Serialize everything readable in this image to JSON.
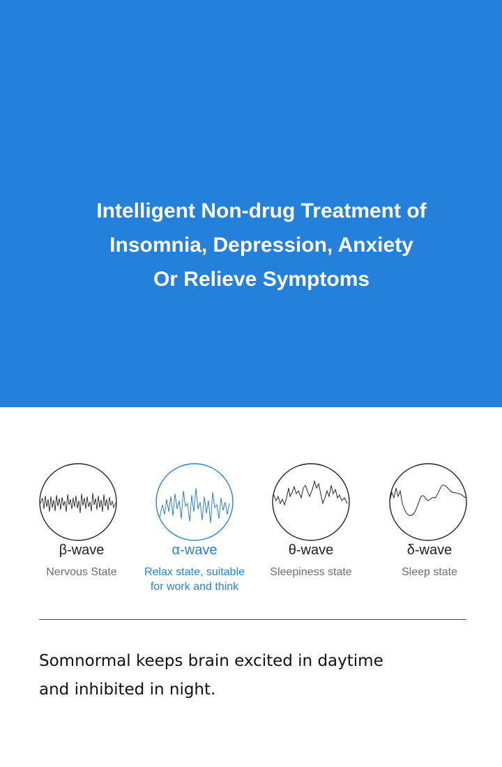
{
  "hero": {
    "title_lines": [
      "Intelligent Non-drug Treatment of",
      "Insomnia, Depression, Anxiety",
      "Or Relieve Symptoms"
    ]
  },
  "colors": {
    "hero_background": "#2480d8",
    "accent": "#2a7fd2",
    "text_dark": "#1e1e1e",
    "text_muted": "#6c6c6c"
  },
  "waves": [
    {
      "name": "β-wave",
      "description": "Nervous State",
      "icon": "beta-wave-icon",
      "highlighted": false
    },
    {
      "name": "α-wave",
      "description": "Relax state,  suitable\nfor work and think",
      "icon": "alpha-wave-icon",
      "highlighted": true
    },
    {
      "name": "θ-wave",
      "description": "Sleepiness state",
      "icon": "theta-wave-icon",
      "highlighted": false
    },
    {
      "name": "δ-wave",
      "description": "Sleep state",
      "icon": "delta-wave-icon",
      "highlighted": false
    }
  ],
  "tagline": {
    "lines": [
      "Somnormal keeps brain excited in daytime",
      "and inhibited in night."
    ]
  }
}
